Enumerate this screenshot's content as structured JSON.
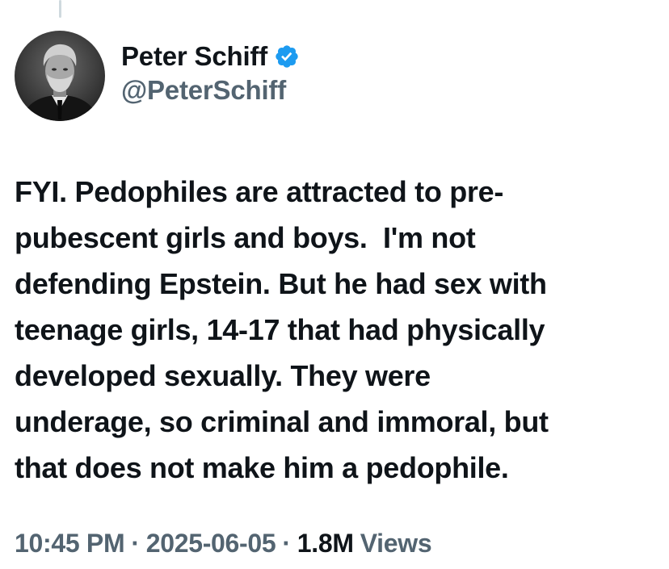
{
  "tweet": {
    "author": {
      "display_name": "Peter Schiff",
      "handle": "@PeterSchiff",
      "verified": true,
      "avatar_icon": "avatar-photo",
      "verified_badge_color": "#1d9bf0"
    },
    "text": "FYI. Pedophiles are attracted to pre-\npubescent girls and boys.  I'm not\ndefending Epstein. But he had sex with\nteenage girls, 14-17 that had physically\ndeveloped sexually. They were\nunderage, so criminal and immoral, but\nthat does not make him a pedophile.",
    "meta": {
      "time": "10:45 PM",
      "separator": "·",
      "date": "2025-06-05",
      "views_count": "1.8M",
      "views_label": "Views"
    }
  }
}
